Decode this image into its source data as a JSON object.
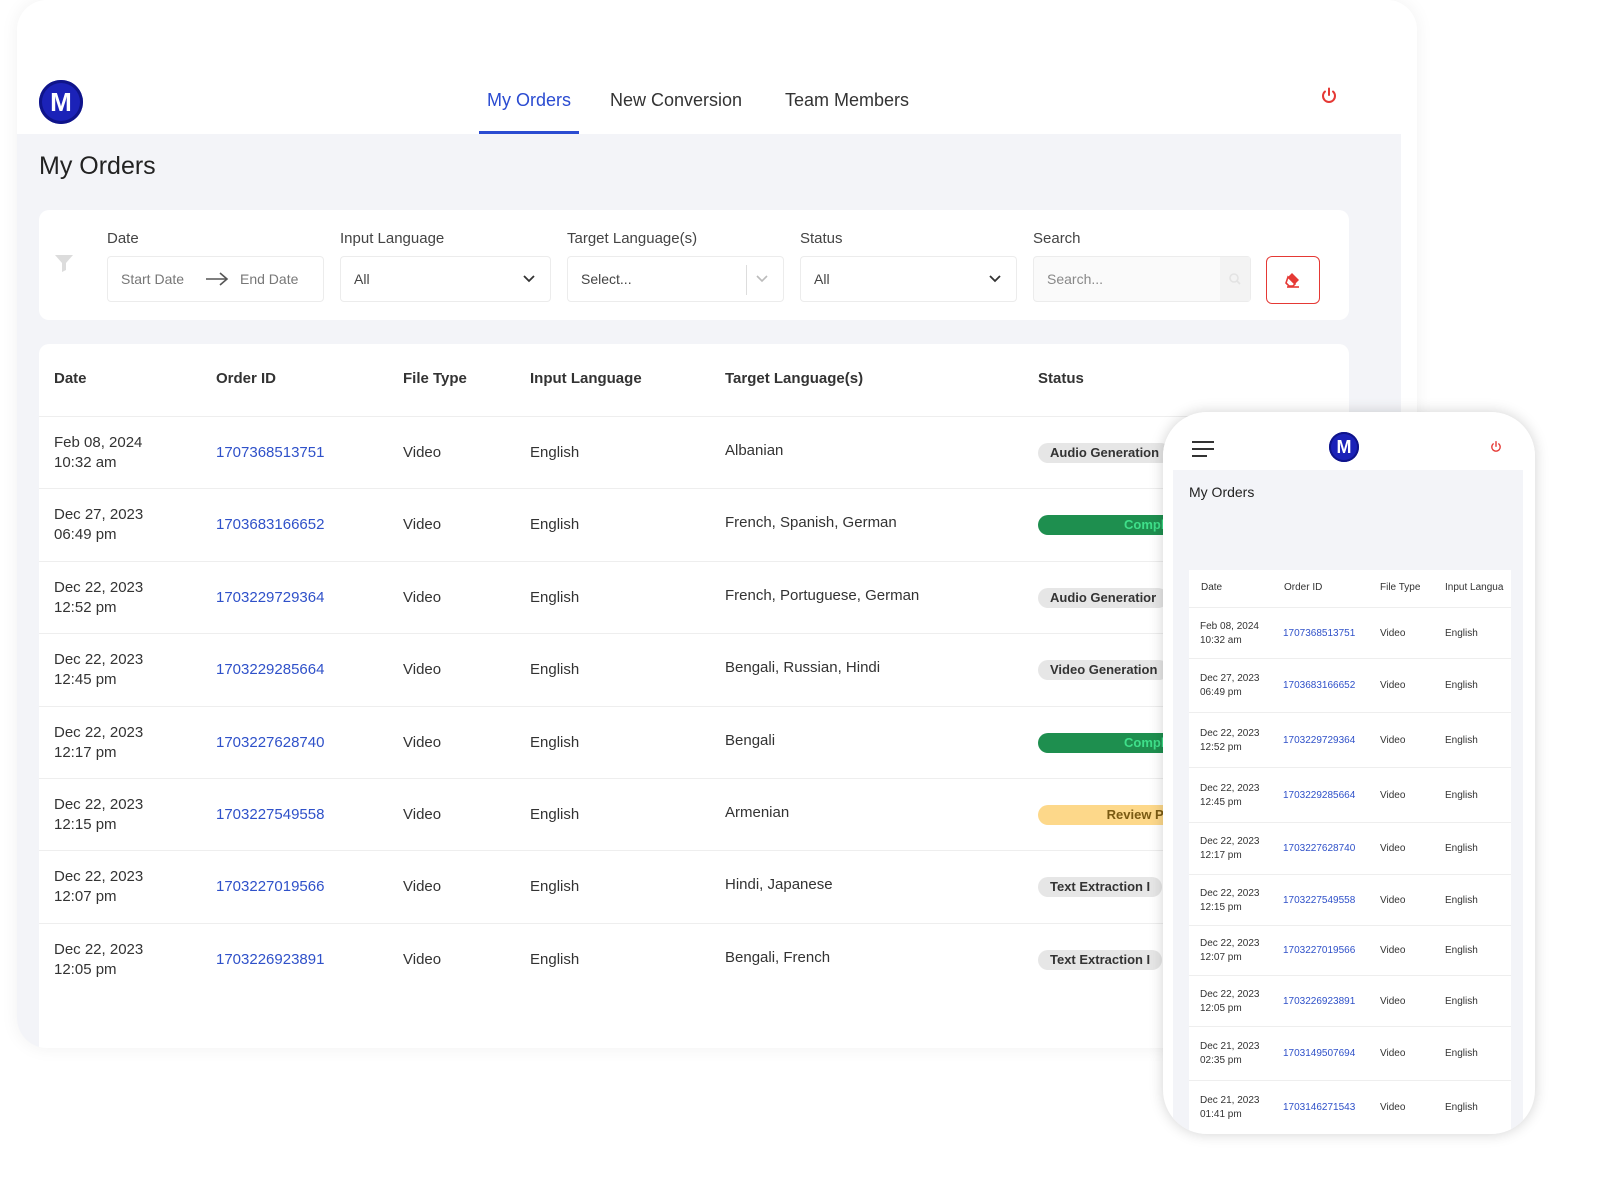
{
  "app": {
    "logo_letter": "M"
  },
  "nav": {
    "tabs": [
      {
        "label": "My Orders",
        "active": true
      },
      {
        "label": "New Conversion",
        "active": false
      },
      {
        "label": "Team Members",
        "active": false
      }
    ],
    "power_icon": "power-icon",
    "accent_color": "#2a4bd1"
  },
  "page": {
    "title": "My Orders"
  },
  "filters": {
    "date_label": "Date",
    "start_placeholder": "Start Date",
    "end_placeholder": "End Date",
    "input_language_label": "Input Language",
    "input_language_value": "All",
    "target_language_label": "Target Language(s)",
    "target_language_placeholder": "Select...",
    "status_label": "Status",
    "status_value": "All",
    "search_label": "Search",
    "search_placeholder": "Search..."
  },
  "table": {
    "columns": [
      "Date",
      "Order ID",
      "File Type",
      "Input Language",
      "Target Language(s)",
      "Status"
    ],
    "rows": [
      {
        "date": "Feb 08, 2024",
        "time": "10:32 am",
        "order_id": "1707368513751",
        "file_type": "Video",
        "input_language": "English",
        "targets": "Albanian",
        "status": "Audio Generation",
        "status_kind": "gray"
      },
      {
        "date": "Dec 27, 2023",
        "time": "06:49 pm",
        "order_id": "1703683166652",
        "file_type": "Video",
        "input_language": "English",
        "targets": "French, Spanish, German",
        "status": "Complet",
        "status_kind": "green"
      },
      {
        "date": "Dec 22, 2023",
        "time": "12:52 pm",
        "order_id": "1703229729364",
        "file_type": "Video",
        "input_language": "English",
        "targets": "French, Portuguese, German",
        "status": "Audio Generatior",
        "status_kind": "gray"
      },
      {
        "date": "Dec 22, 2023",
        "time": "12:45 pm",
        "order_id": "1703229285664",
        "file_type": "Video",
        "input_language": "English",
        "targets": "Bengali, Russian, Hindi",
        "status": "Video Generation",
        "status_kind": "gray"
      },
      {
        "date": "Dec 22, 2023",
        "time": "12:17 pm",
        "order_id": "1703227628740",
        "file_type": "Video",
        "input_language": "English",
        "targets": "Bengali",
        "status": "Complet",
        "status_kind": "green"
      },
      {
        "date": "Dec 22, 2023",
        "time": "12:15 pm",
        "order_id": "1703227549558",
        "file_type": "Video",
        "input_language": "English",
        "targets": "Armenian",
        "status": "Review Per",
        "status_kind": "yellow"
      },
      {
        "date": "Dec 22, 2023",
        "time": "12:07 pm",
        "order_id": "1703227019566",
        "file_type": "Video",
        "input_language": "English",
        "targets": "Hindi, Japanese",
        "status": "Text Extraction I",
        "status_kind": "gray"
      },
      {
        "date": "Dec 22, 2023",
        "time": "12:05 pm",
        "order_id": "1703226923891",
        "file_type": "Video",
        "input_language": "English",
        "targets": "Bengali, French",
        "status": "Text Extraction I",
        "status_kind": "gray"
      }
    ]
  },
  "status_colors": {
    "gray": "#e6e6e6",
    "green": "#1e8f4f",
    "yellow": "#fdd88a"
  },
  "mobile": {
    "title": "My Orders",
    "columns": [
      "Date",
      "Order ID",
      "File Type",
      "Input Langua"
    ],
    "rows": [
      {
        "date": "Feb 08, 2024",
        "time": "10:32 am",
        "order_id": "1707368513751",
        "file_type": "Video",
        "input_language": "English"
      },
      {
        "date": "Dec 27, 2023",
        "time": "06:49 pm",
        "order_id": "1703683166652",
        "file_type": "Video",
        "input_language": "English"
      },
      {
        "date": "Dec 22, 2023",
        "time": "12:52 pm",
        "order_id": "1703229729364",
        "file_type": "Video",
        "input_language": "English"
      },
      {
        "date": "Dec 22, 2023",
        "time": "12:45 pm",
        "order_id": "1703229285664",
        "file_type": "Video",
        "input_language": "English"
      },
      {
        "date": "Dec 22, 2023",
        "time": "12:17 pm",
        "order_id": "1703227628740",
        "file_type": "Video",
        "input_language": "English"
      },
      {
        "date": "Dec 22, 2023",
        "time": "12:15 pm",
        "order_id": "1703227549558",
        "file_type": "Video",
        "input_language": "English"
      },
      {
        "date": "Dec 22, 2023",
        "time": "12:07 pm",
        "order_id": "1703227019566",
        "file_type": "Video",
        "input_language": "English"
      },
      {
        "date": "Dec 22, 2023",
        "time": "12:05 pm",
        "order_id": "1703226923891",
        "file_type": "Video",
        "input_language": "English"
      },
      {
        "date": "Dec 21, 2023",
        "time": "02:35 pm",
        "order_id": "1703149507694",
        "file_type": "Video",
        "input_language": "English"
      },
      {
        "date": "Dec 21, 2023",
        "time": "01:41 pm",
        "order_id": "1703146271543",
        "file_type": "Video",
        "input_language": "English"
      }
    ]
  }
}
